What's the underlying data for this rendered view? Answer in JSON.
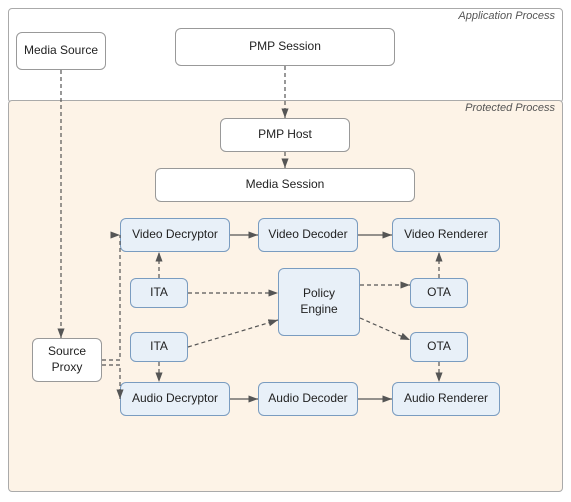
{
  "regions": {
    "app_process_label": "Application Process",
    "protected_process_label": "Protected Process"
  },
  "boxes": {
    "media_source": "Media Source",
    "pmp_session": "PMP Session",
    "pmp_host": "PMP Host",
    "media_session": "Media Session",
    "video_decryptor": "Video Decryptor",
    "video_decoder": "Video Decoder",
    "video_renderer": "Video Renderer",
    "ita_top": "ITA",
    "ota_top": "OTA",
    "policy_engine": "Policy\nEngine",
    "ita_bottom": "ITA",
    "ota_bottom": "OTA",
    "audio_decryptor": "Audio Decryptor",
    "audio_decoder": "Audio Decoder",
    "audio_renderer": "Audio Renderer",
    "source_proxy": "Source\nProxy"
  }
}
